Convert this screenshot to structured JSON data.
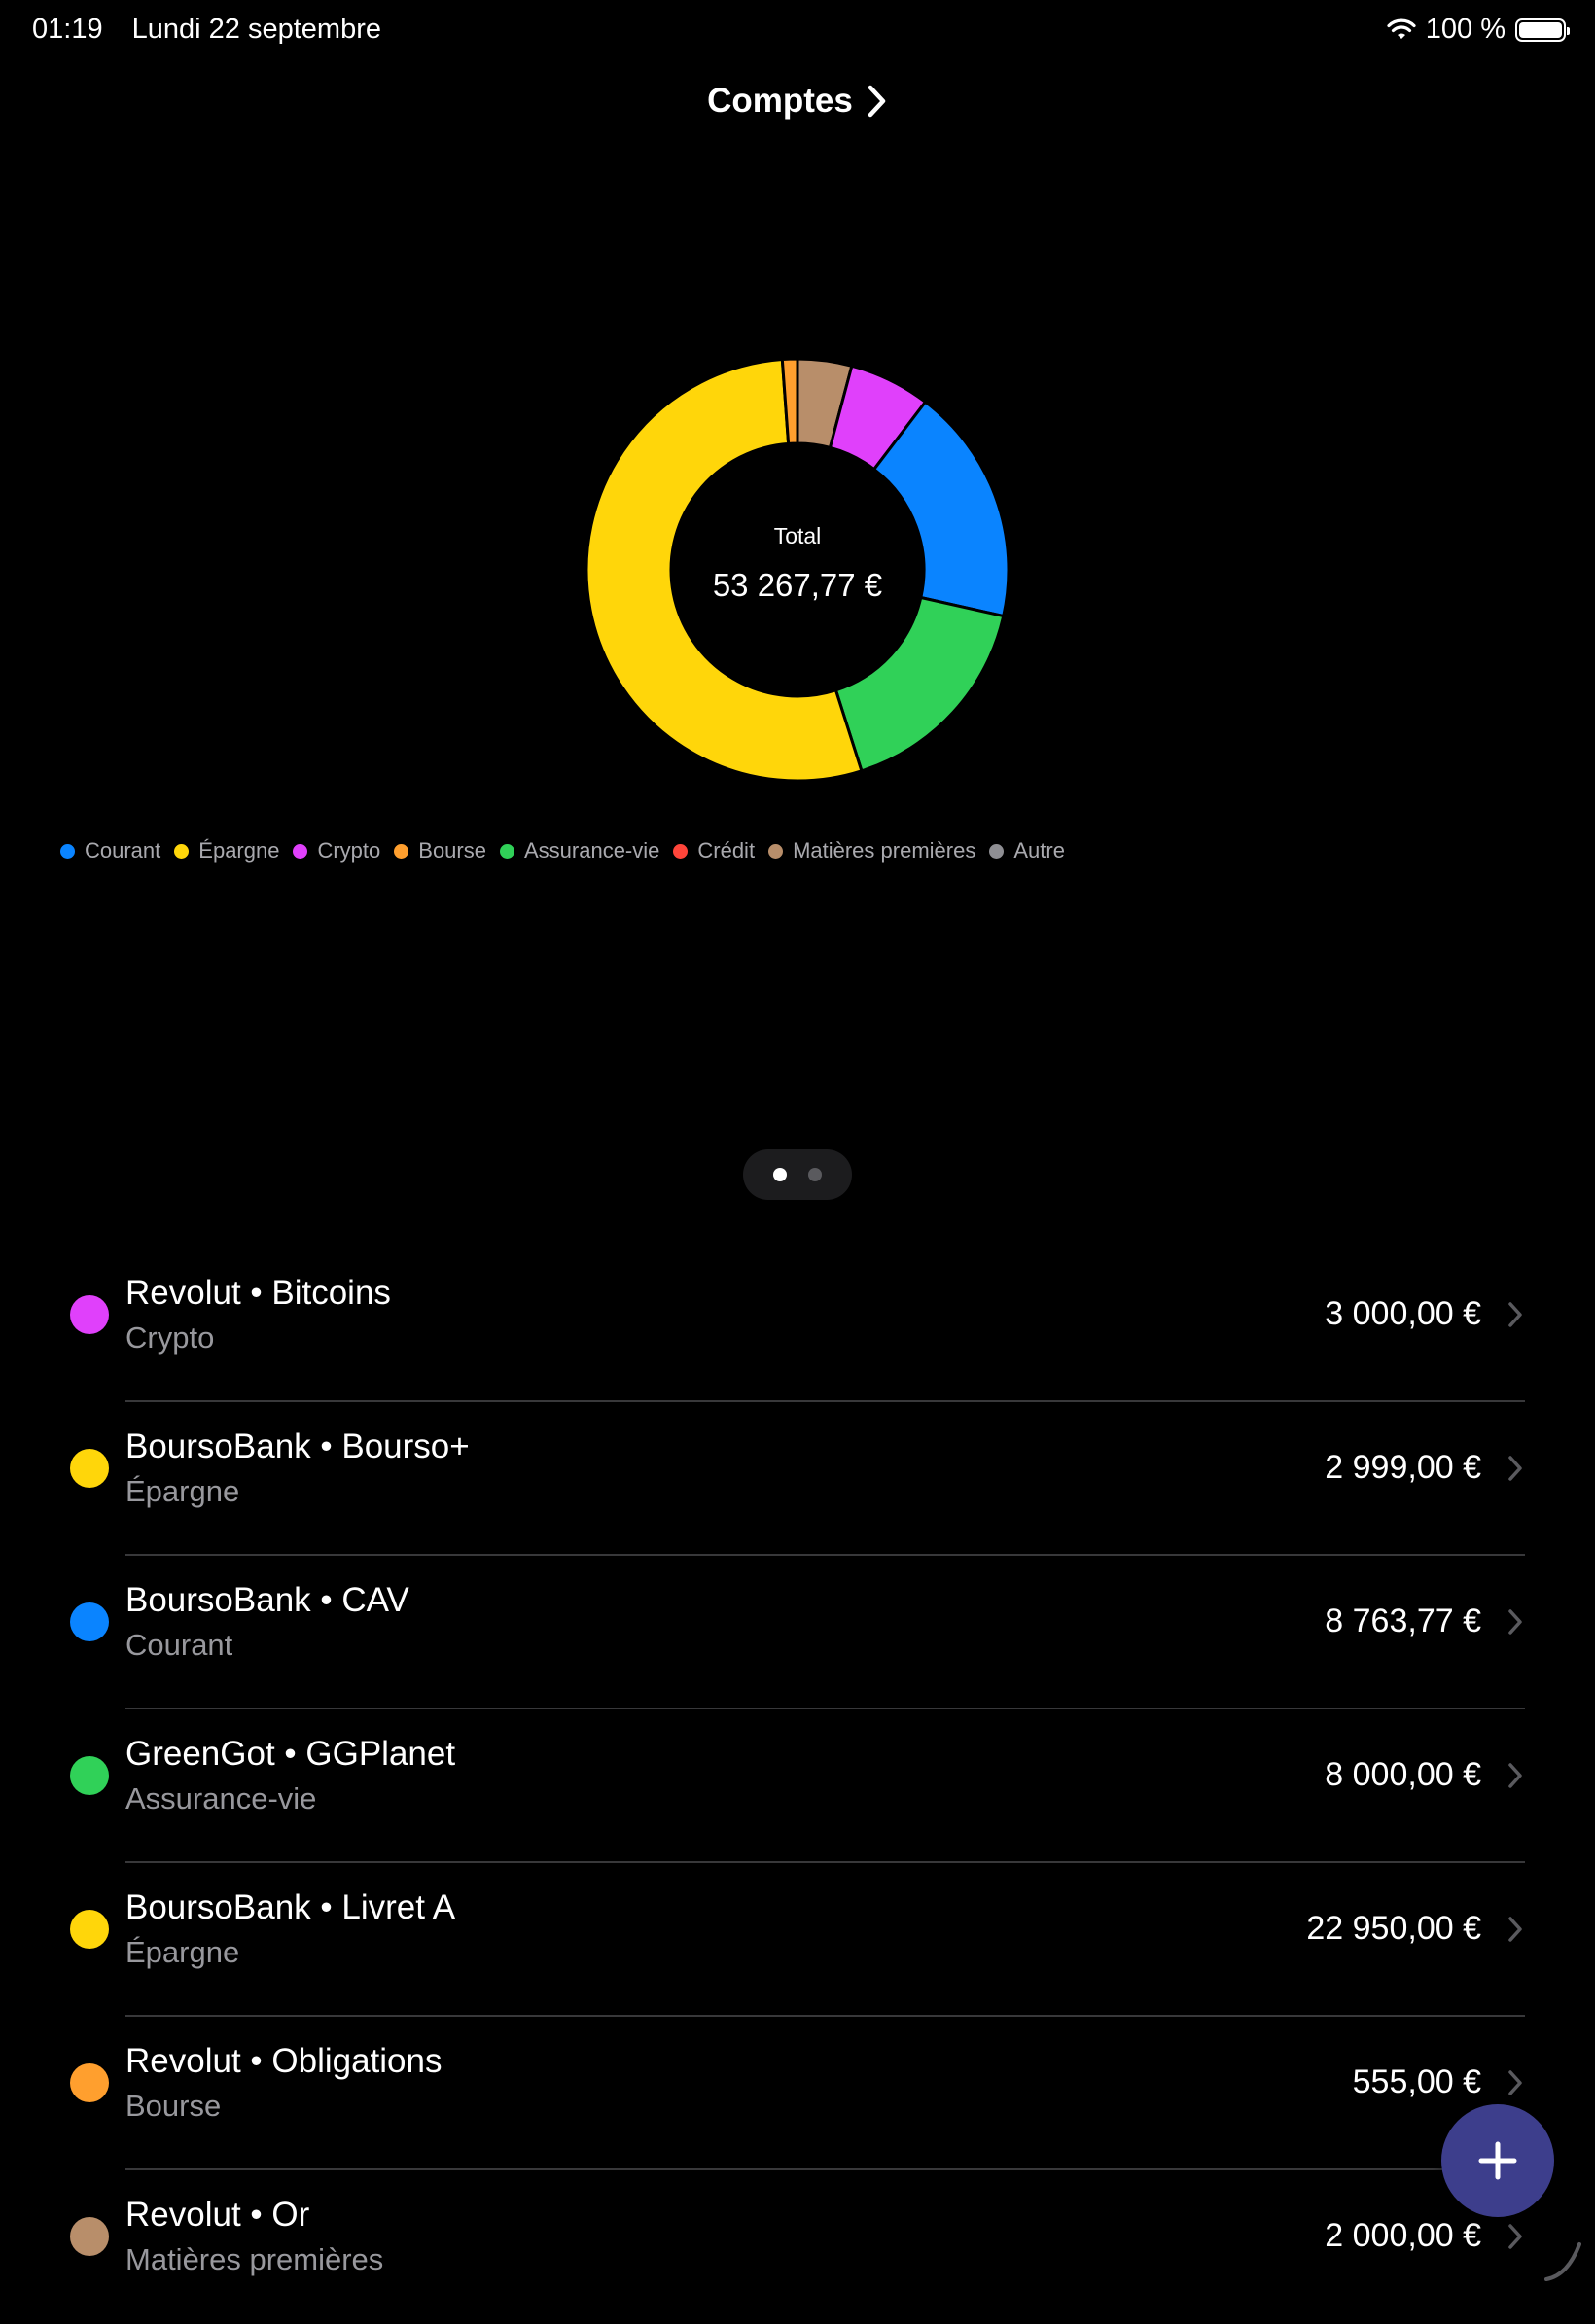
{
  "status_bar": {
    "time": "01:19",
    "date": "Lundi 22 septembre",
    "battery_text": "100 %"
  },
  "header": {
    "title": "Comptes"
  },
  "chart_data": {
    "type": "pie",
    "center_label": "Total",
    "center_value": "53 267,77 €",
    "slices": [
      {
        "label": "Matières premières",
        "value": 2000.0,
        "color": "#B88E6A"
      },
      {
        "label": "Crypto",
        "value": 3000.0,
        "color": "#E040FB"
      },
      {
        "label": "Courant",
        "value": 8763.77,
        "color": "#0A84FF"
      },
      {
        "label": "Assurance-vie",
        "value": 8000.0,
        "color": "#30D158"
      },
      {
        "label": "Épargne",
        "value": 25949.0,
        "color": "#FFD60A"
      },
      {
        "label": "Bourse",
        "value": 555.0,
        "color": "#FF9F2E"
      }
    ],
    "legend": [
      {
        "label": "Courant",
        "color": "#0A84FF"
      },
      {
        "label": "Épargne",
        "color": "#FFD60A"
      },
      {
        "label": "Crypto",
        "color": "#E040FB"
      },
      {
        "label": "Bourse",
        "color": "#FF9F2E"
      },
      {
        "label": "Assurance-vie",
        "color": "#30D158"
      },
      {
        "label": "Crédit",
        "color": "#FF453A"
      },
      {
        "label": "Matières premières",
        "color": "#B88E6A"
      },
      {
        "label": "Autre",
        "color": "#8E8E93"
      }
    ]
  },
  "pager": {
    "pages": 2,
    "current": 1
  },
  "accounts": [
    {
      "name": "Revolut • Bitcoins",
      "type": "Crypto",
      "amount": "3 000,00 €",
      "color": "#E040FB"
    },
    {
      "name": "BoursoBank • Bourso+",
      "type": "Épargne",
      "amount": "2 999,00 €",
      "color": "#FFD60A"
    },
    {
      "name": "BoursoBank • CAV",
      "type": "Courant",
      "amount": "8 763,77 €",
      "color": "#0A84FF"
    },
    {
      "name": "GreenGot • GGPlanet",
      "type": "Assurance-vie",
      "amount": "8 000,00 €",
      "color": "#30D158"
    },
    {
      "name": "BoursoBank • Livret A",
      "type": "Épargne",
      "amount": "22 950,00 €",
      "color": "#FFD60A"
    },
    {
      "name": "Revolut • Obligations",
      "type": "Bourse",
      "amount": "555,00 €",
      "color": "#FF9F2E"
    },
    {
      "name": "Revolut • Or",
      "type": "Matières premières",
      "amount": "2 000,00 €",
      "color": "#B88E6A"
    }
  ],
  "icons": {
    "wifi": "wifi-icon",
    "battery": "battery-icon",
    "title_chevron": "chevron-right-icon",
    "row_chevron": "chevron-right-icon",
    "fab": "plus-icon"
  }
}
